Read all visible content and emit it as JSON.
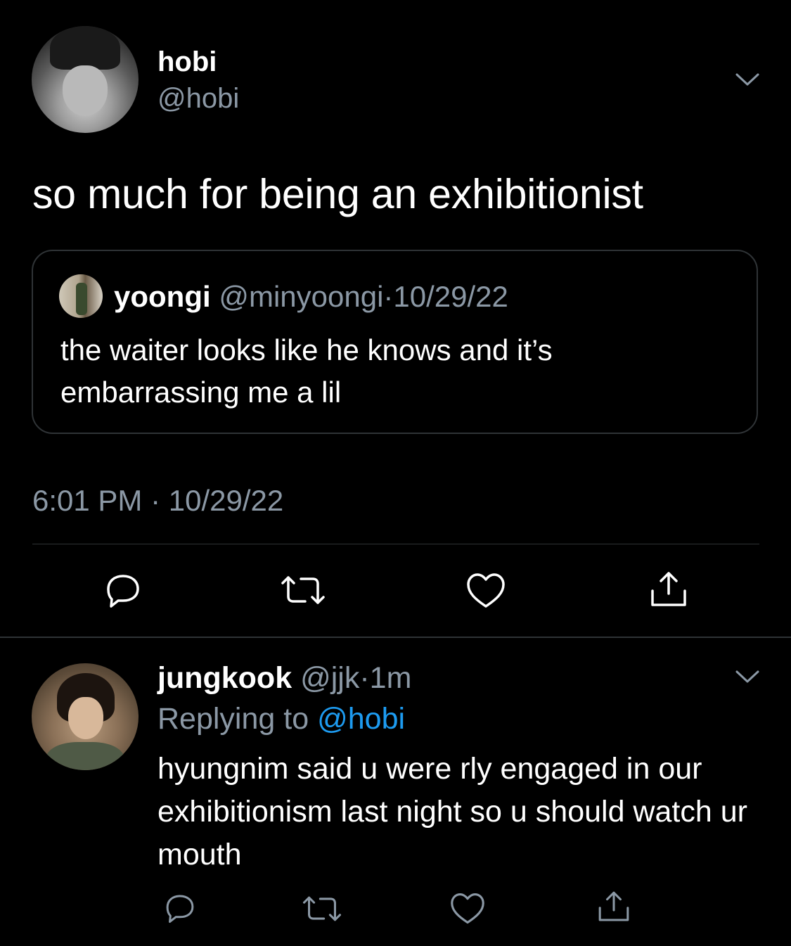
{
  "main_tweet": {
    "author": {
      "display_name": "hobi",
      "handle": "@hobi"
    },
    "text": "so much for being an exhibitionist",
    "quote": {
      "display_name": "yoongi",
      "handle": "@minyoongi",
      "separator": "·",
      "date": "10/29/22",
      "text": "the waiter looks like he knows and it’s embarrassing me a lil"
    },
    "timestamp": "6:01 PM · 10/29/22",
    "actions": [
      "reply-icon",
      "retweet-icon",
      "like-icon",
      "share-icon"
    ]
  },
  "reply": {
    "display_name": "jungkook",
    "handle": "@jjk",
    "separator": "·",
    "time_ago": "1m",
    "replying_to_prefix": "Replying to",
    "replying_to_mention": "@hobi",
    "text": "hyungnim said u were rly engaged in our exhibitionism last night so u should watch ur mouth",
    "actions": [
      "reply-icon",
      "retweet-icon",
      "like-icon",
      "share-icon"
    ]
  },
  "colors": {
    "background": "#000000",
    "text": "#ffffff",
    "secondary": "#8b98a5",
    "accent": "#1d9bf0",
    "border": "#2f3336"
  }
}
